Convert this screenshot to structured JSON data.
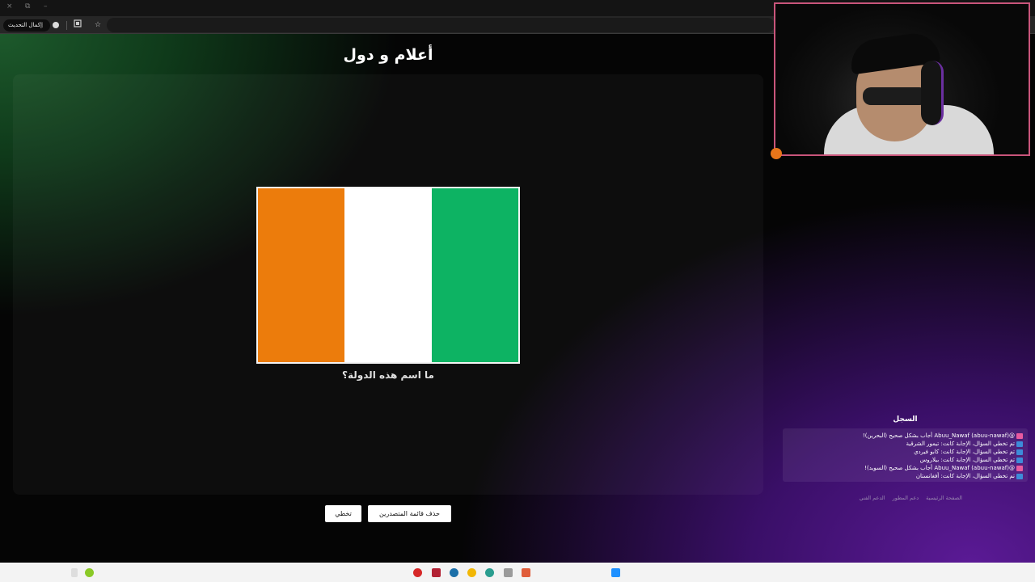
{
  "browser": {
    "update_button_label": "إكمال التحديث",
    "window_controls": {
      "close": "×",
      "restore": "⧉",
      "minimize": "–"
    },
    "toolbar_icons": [
      "extensions-icon",
      "bookmark-star-icon"
    ]
  },
  "game": {
    "title": "أعلام و دول",
    "question": "ما اسم هذه الدولة؟",
    "flag": {
      "stripes": [
        "#ec7c0c",
        "#ffffff",
        "#0db363"
      ]
    },
    "buttons": {
      "skip_label": "تخطي",
      "clear_leaderboard_label": "حذف قائمة المتصدرين"
    }
  },
  "log": {
    "title": "السجل",
    "entries": [
      {
        "icon": "party-icon",
        "icon_color": "#e85aa0",
        "text": "‏@Abuu_Nawaf (abuu-nawaf) أجاب بشكل صحيح (البحرين)!"
      },
      {
        "icon": "skip-icon",
        "icon_color": "#3d8bd9",
        "text": "تم تخطي السؤال، الإجابة كانت: تيمور الشرقية"
      },
      {
        "icon": "skip-icon",
        "icon_color": "#3d8bd9",
        "text": "تم تخطي السؤال، الإجابة كانت: كابو فيردي"
      },
      {
        "icon": "skip-icon",
        "icon_color": "#3d8bd9",
        "text": "تم تخطي السؤال، الإجابة كانت: بيلاروس"
      },
      {
        "icon": "party-icon",
        "icon_color": "#e85aa0",
        "text": "‏@Abuu_Nawaf (abuu-nawaf) أجاب بشكل صحيح (السويد)!"
      },
      {
        "icon": "skip-icon",
        "icon_color": "#3d8bd9",
        "text": "تم تخطي السؤال، الإجابة كانت: أفغانستان"
      }
    ]
  },
  "footer": {
    "links": [
      "الصفحة الرئيسية",
      "دعم المطور",
      "الدعم الفني"
    ]
  },
  "taskbar": {
    "icons": [
      "record-icon",
      "media-player-icon",
      "steam-icon",
      "chrome-icon",
      "chrome-canary-icon",
      "folder-icon",
      "app-icon",
      "windows-start-icon"
    ]
  },
  "colors": {
    "accent_purple": "#5b1a96",
    "accent_green": "#1d5a2c",
    "webcam_border": "#c9557b"
  }
}
